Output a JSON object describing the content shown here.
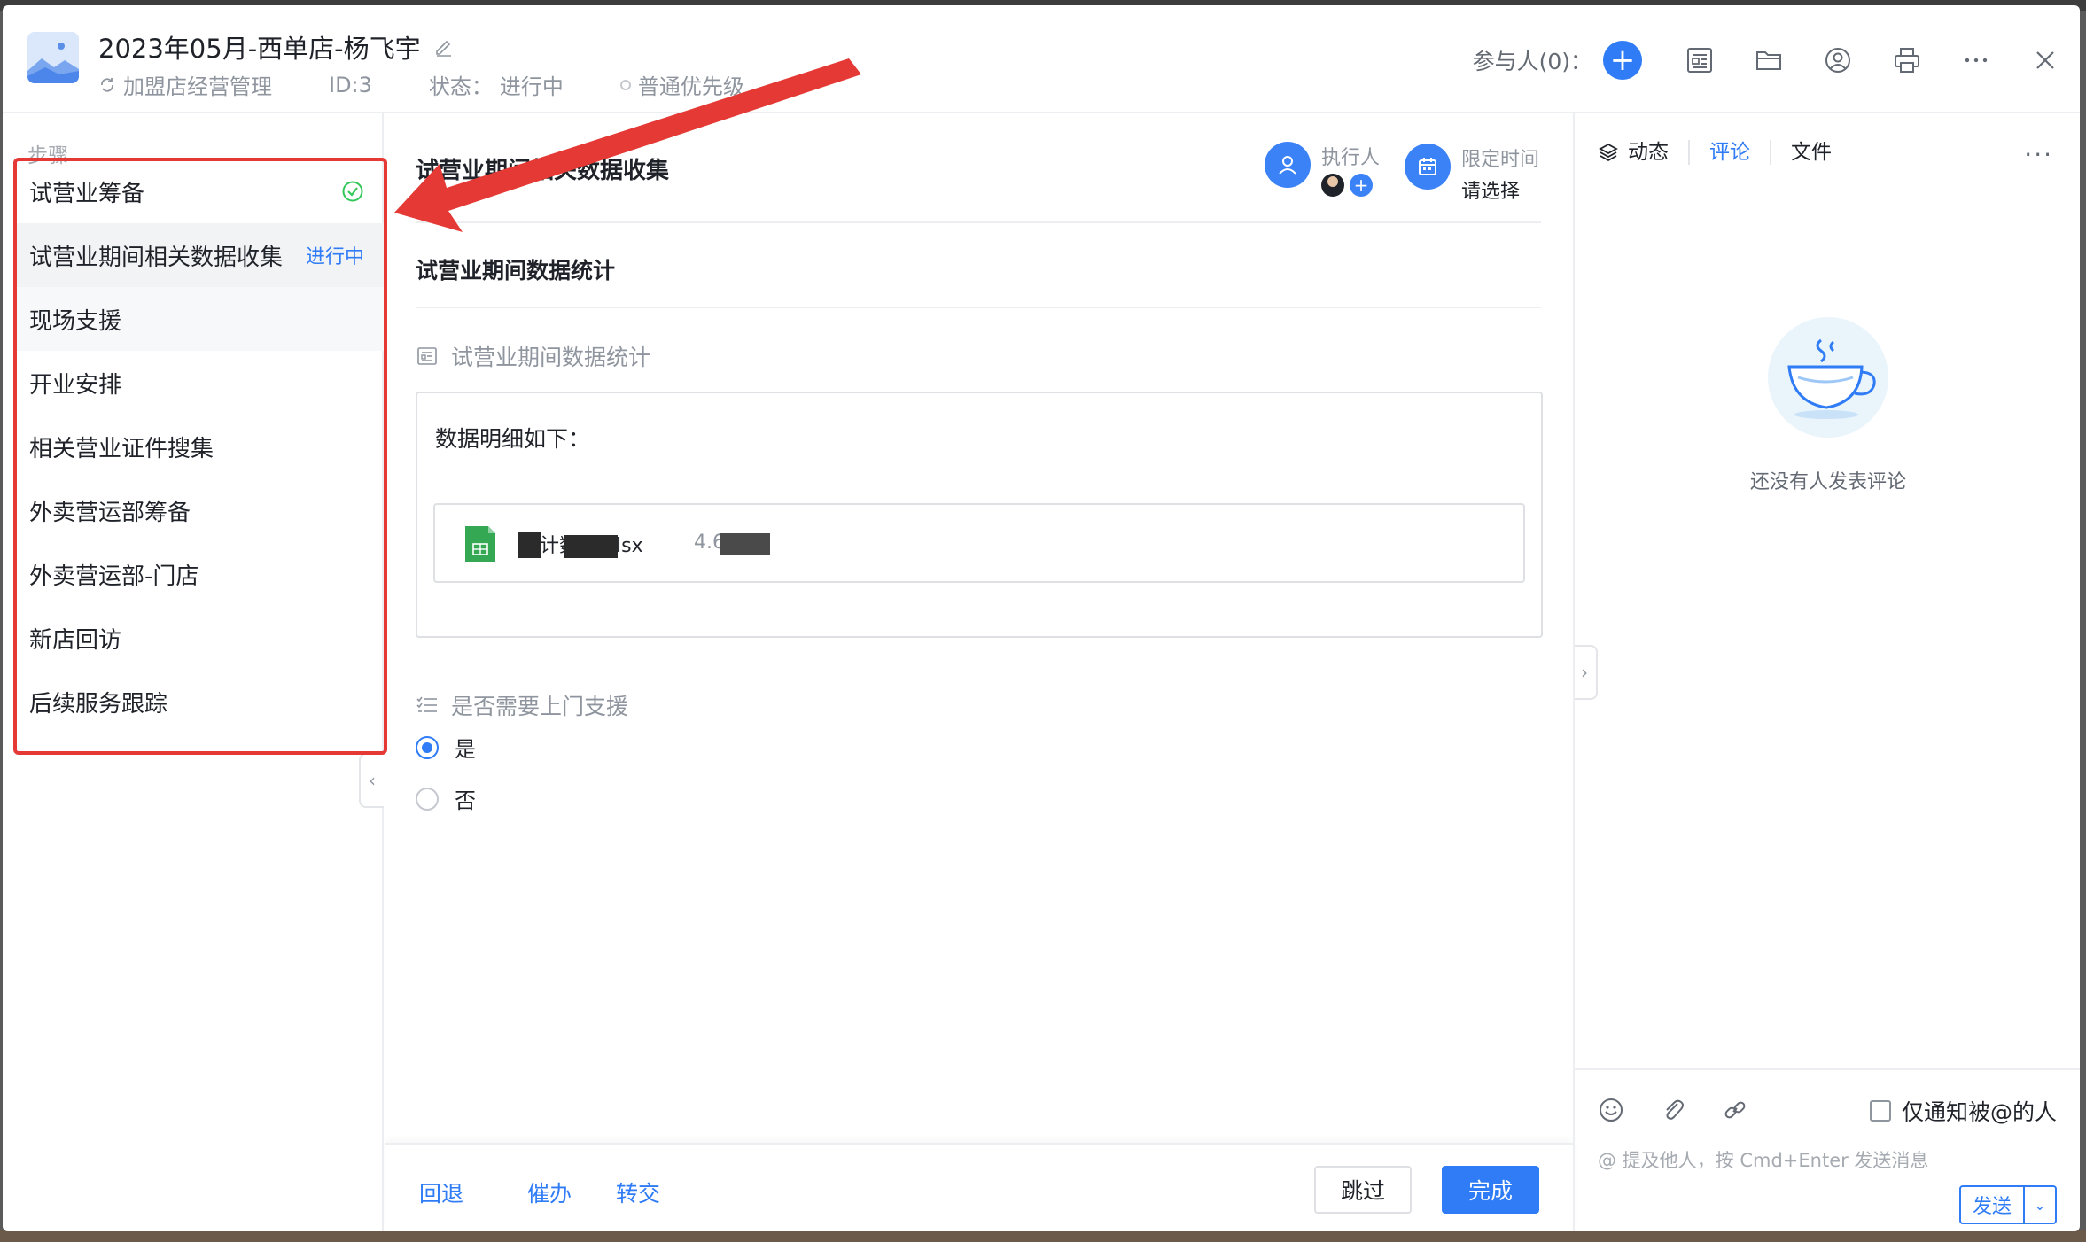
{
  "header": {
    "title": "2023年05月-西单店-杨飞宇",
    "project": "加盟店经营管理",
    "id_label": "ID:3",
    "status_label": "状态：",
    "status_value": "进行中",
    "priority": "普通优先级",
    "participants_label": "参与人(0)："
  },
  "steps": {
    "label": "步骤",
    "items": [
      {
        "label": "试营业筹备",
        "status": "done"
      },
      {
        "label": "试营业期间相关数据收集",
        "status_text": "进行中"
      },
      {
        "label": "现场支援"
      },
      {
        "label": "开业安排"
      },
      {
        "label": "相关营业证件搜集"
      },
      {
        "label": "外卖营运部筹备"
      },
      {
        "label": "外卖营运部-门店"
      },
      {
        "label": "新店回访"
      },
      {
        "label": "后续服务跟踪"
      }
    ]
  },
  "main": {
    "step_title": "试营业期间相关数据收集",
    "executor_label": "执行人",
    "deadline_label": "限定时间",
    "deadline_value": "请选择",
    "form_heading": "试营业期间数据统计",
    "field1_label": "试营业期间数据统计",
    "rich_text": "数据明细如下：",
    "file_name": "统计数据.xlsx",
    "file_size": "4.6KB",
    "field2_label": "是否需要上门支援",
    "radio_yes": "是",
    "radio_no": "否",
    "footer": {
      "rollback": "回退",
      "urge": "催办",
      "transfer": "转交",
      "skip": "跳过",
      "done": "完成"
    }
  },
  "right": {
    "tabs": [
      "动态",
      "评论",
      "文件"
    ],
    "active_tab": "评论",
    "empty_text": "还没有人发表评论",
    "notify_label": "仅通知被@的人",
    "input_placeholder": "@ 提及他人，按 Cmd+Enter 发送消息",
    "send_label": "发送"
  },
  "colors": {
    "accent": "#2f7cf6",
    "annotation": "#e53935",
    "success": "#34c759"
  }
}
